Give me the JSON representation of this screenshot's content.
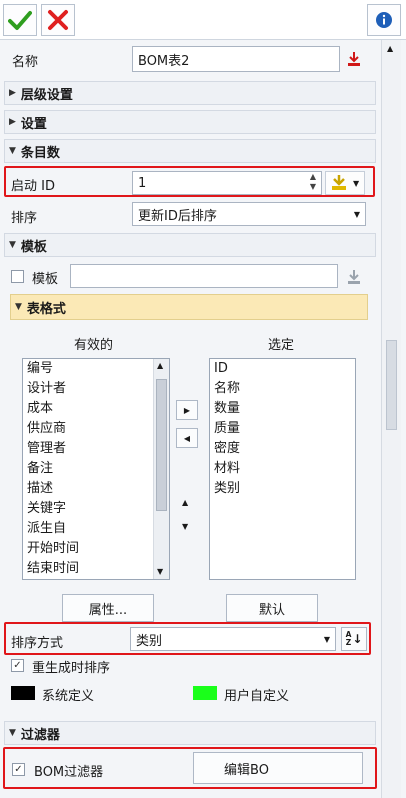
{
  "toolbar": {
    "ok_icon": "checkmark-icon",
    "cancel_icon": "cross-icon",
    "info_icon": "info-icon"
  },
  "name_row": {
    "label": "名称",
    "value": "BOM表2"
  },
  "sections": {
    "levels": "层级设置",
    "settings": "设置",
    "entries": "条目数",
    "template": "模板",
    "table_format": "表格式",
    "filter": "过滤器"
  },
  "start_id": {
    "label": "启动 ID",
    "value": "1"
  },
  "sort_row": {
    "label": "排序",
    "value": "更新ID后排序"
  },
  "template_row": {
    "label": "模板"
  },
  "format": {
    "available_header": "有效的",
    "selected_header": "选定",
    "available": [
      "编号",
      "设计者",
      "成本",
      "供应商",
      "管理者",
      "备注",
      "描述",
      "关键字",
      "派生自",
      "开始时间",
      "结束时间"
    ],
    "selected": [
      "ID",
      "名称",
      "数量",
      "质量",
      "密度",
      "材料",
      "类别"
    ],
    "properties_button": "属性...",
    "default_button": "默认"
  },
  "sort_mode": {
    "label": "排序方式",
    "value": "类别",
    "sort_icon": "A-Z"
  },
  "regen_sort": {
    "label": "重生成时排序",
    "checked": true
  },
  "legend": {
    "system": "系统定义",
    "user": "用户自定义",
    "system_color": "#000000",
    "user_color": "#1aff1a"
  },
  "bom_filter": {
    "label": "BOM过滤器",
    "checked": true,
    "edit_button": "编辑BO"
  }
}
